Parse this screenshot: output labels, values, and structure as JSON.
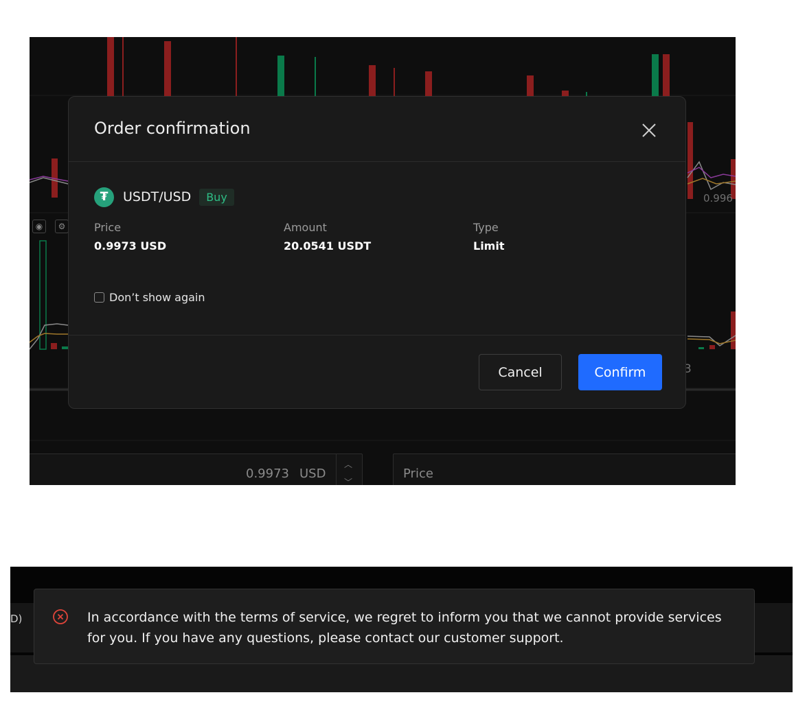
{
  "modal": {
    "title": "Order confirmation",
    "pair": "USDT/USD",
    "coin_symbol": "₮",
    "side": "Buy",
    "fields": [
      {
        "label": "Price",
        "value": "0.9973 USD"
      },
      {
        "label": "Amount",
        "value": "20.0541 USDT"
      },
      {
        "label": "Type",
        "value": "Limit"
      }
    ],
    "dont_show_label": "Don’t show again",
    "dont_show_checked": false,
    "cancel_label": "Cancel",
    "confirm_label": "Confirm",
    "icons": {
      "close": "close-icon",
      "coin": "tether-coin-icon"
    }
  },
  "background": {
    "price_axis_label": "0.996",
    "price_input_value": "0.9973",
    "price_input_unit": "USD",
    "price_input_placeholder": "Price",
    "axis_fragment": "3"
  },
  "toast": {
    "message": "In accordance with the terms of service, we regret to inform you that we cannot provide services for you. If you have any questions, please contact our customer support.",
    "edge_fragment": "D)",
    "icon": "error-circle-icon"
  },
  "colors": {
    "up": "#0a7a4a",
    "down": "#8b1e1e",
    "confirm": "#1f6bff",
    "buy_badge_text": "#2ebd85",
    "error": "#e0453a"
  }
}
